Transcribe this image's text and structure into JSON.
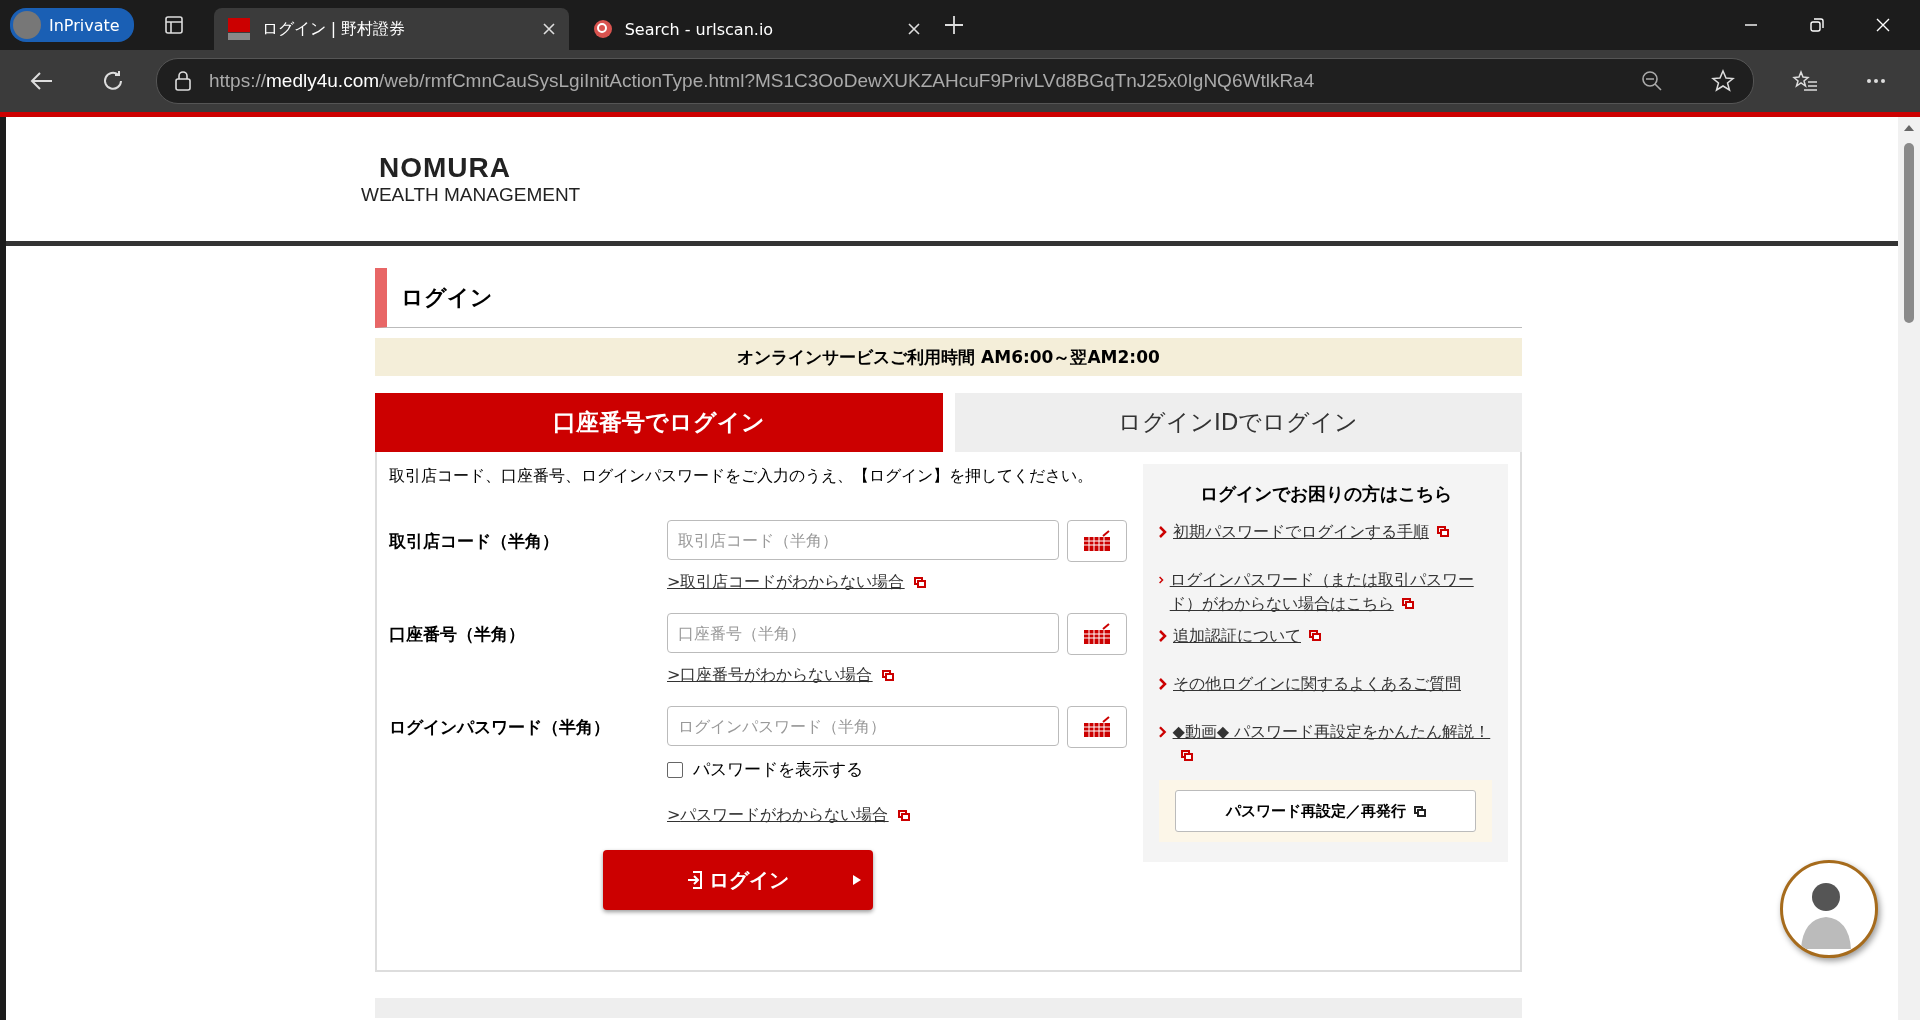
{
  "browser": {
    "profile": "InPrivate",
    "tabs": [
      {
        "title": "ログイン | 野村證券",
        "selected": true,
        "kind": "brand"
      },
      {
        "title": "Search - urlscan.io",
        "selected": false,
        "kind": "search"
      }
    ],
    "url": {
      "scheme": "https://",
      "host": "medly4u.com",
      "path": "/web/rmfCmnCauSysLgiInitActionType.html?MS1C3OoDewXUKZAHcuF9PrivLVd8BGqTnJ25x0IgNQ6WtlkRa4"
    }
  },
  "logo": {
    "line1": "NOMURA",
    "line2": "WEALTH MANAGEMENT"
  },
  "heading": "ログイン",
  "notice": "オンラインサービスご利用時間 AM6:00～翌AM2:00",
  "login_tabs": [
    {
      "label": "口座番号でログイン",
      "selected": true
    },
    {
      "label": "ログインIDでログイン",
      "selected": false
    }
  ],
  "intro": "取引店コード、口座番号、ログインパスワードをご入力のうえ、【ログイン】を押してください。",
  "fields": [
    {
      "label": "取引店コード（半角）",
      "placeholder": "取引店コード（半角）",
      "help": "取引店コードがわからない場合"
    },
    {
      "label": "口座番号（半角）",
      "placeholder": "口座番号（半角）",
      "help": "口座番号がわからない場合"
    },
    {
      "label": "ログインパスワード（半角）",
      "placeholder": "ログインパスワード（半角）",
      "show_password": {
        "label": "パスワードを表示する",
        "checked": false
      },
      "help": "パスワードがわからない場合"
    }
  ],
  "help_prefix": ">",
  "login_button": "ログイン",
  "help_panel": {
    "title": "ログインでお困りの方はこちら",
    "links": [
      {
        "text": "初期パスワードでログインする手順",
        "external": true
      },
      {
        "text": "ログインパスワード（または取引パスワード）がわからない場合はこちら",
        "external": true
      },
      {
        "text": "追加認証について",
        "external": true
      },
      {
        "text": "その他ログインに関するよくあるご質問",
        "external": false
      },
      {
        "text": "◆動画◆ パスワード再設定をかんたん解説！",
        "external": true
      }
    ],
    "button": "パスワード再設定／再発行"
  }
}
